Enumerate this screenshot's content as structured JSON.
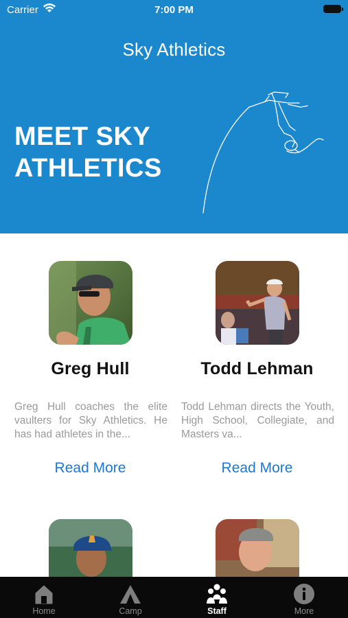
{
  "status": {
    "carrier": "Carrier",
    "time": "7:00 PM"
  },
  "app": {
    "title": "Sky Athletics"
  },
  "hero": {
    "line1": "MEET SKY",
    "line2": "ATHLETICS"
  },
  "staff": [
    {
      "name": "Greg Hull",
      "bio": "Greg Hull coaches the elite vaulters for Sky Athletics. He has had athletes in the...",
      "read_more": "Read More"
    },
    {
      "name": "Todd  Lehman",
      "bio": "Todd Lehman directs the Youth, High School, Collegiate, and Masters va...",
      "read_more": "Read More"
    }
  ],
  "tabs": [
    {
      "label": "Home",
      "icon": "home-icon"
    },
    {
      "label": "Camp",
      "icon": "camp-icon"
    },
    {
      "label": "Staff",
      "icon": "staff-icon",
      "active": true
    },
    {
      "label": "More",
      "icon": "info-icon"
    }
  ],
  "colors": {
    "header": "#1b87cc",
    "link": "#1a78d6",
    "tabbar": "#0a0a0a"
  }
}
